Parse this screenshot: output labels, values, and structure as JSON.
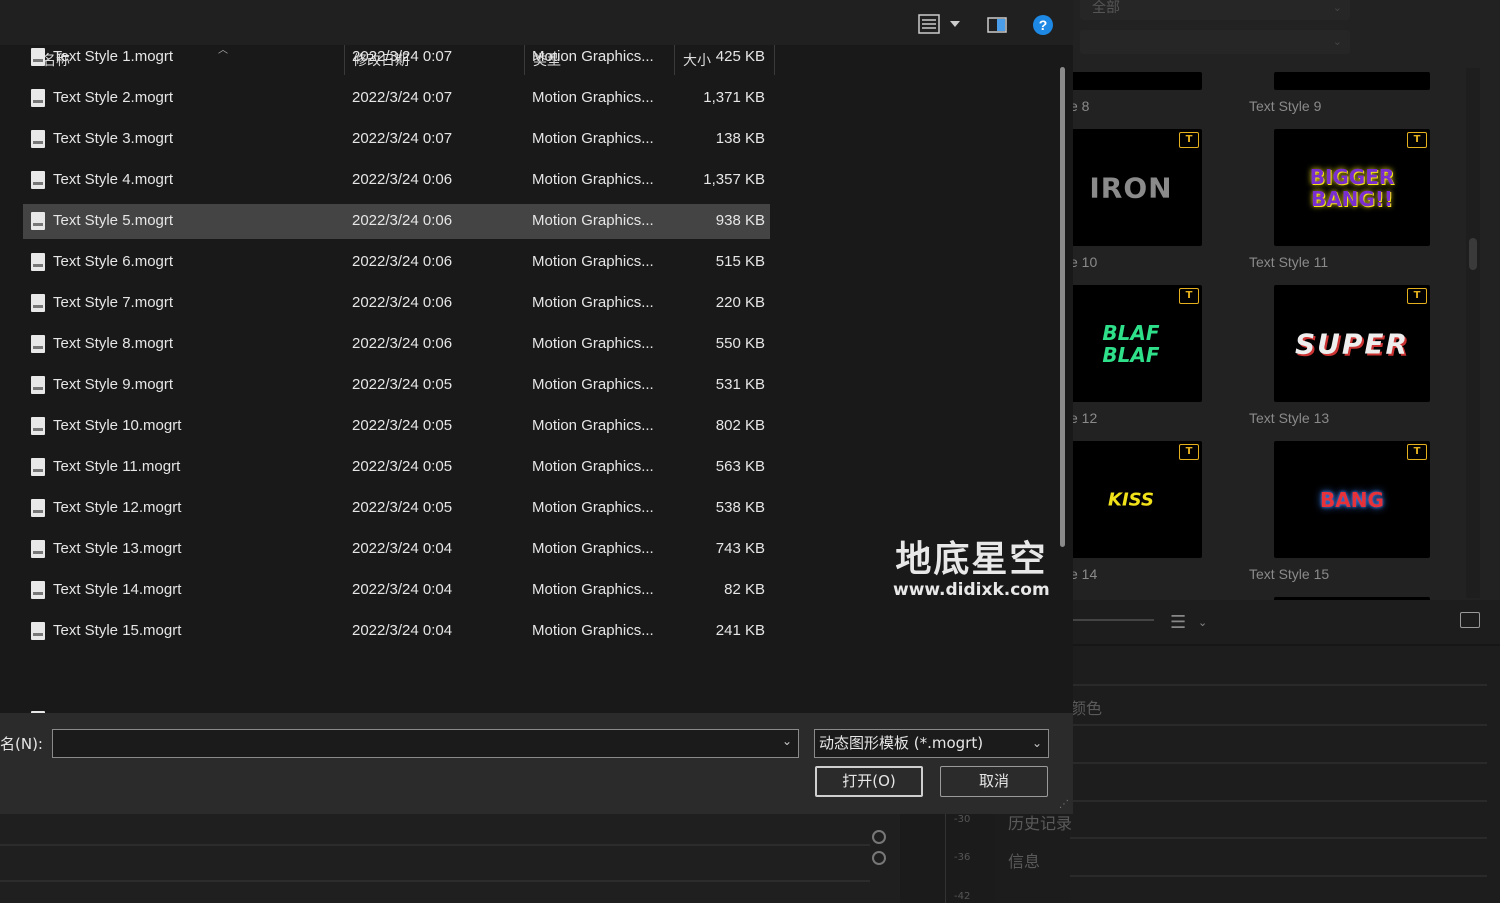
{
  "toolbar": {
    "view_icon": "details-view-icon",
    "dropdown_icon": "chevron-down-icon",
    "preview_icon": "preview-pane-icon",
    "help_icon": "help-icon",
    "help_glyph": "?"
  },
  "columns": {
    "name": "名称",
    "date": "修改日期",
    "type": "类型",
    "size": "大小"
  },
  "files": [
    {
      "name": "Text Style 1.mogrt",
      "date": "2022/3/24 0:07",
      "type": "Motion Graphics...",
      "size": "425 KB"
    },
    {
      "name": "Text Style 2.mogrt",
      "date": "2022/3/24 0:07",
      "type": "Motion Graphics...",
      "size": "1,371 KB"
    },
    {
      "name": "Text Style 3.mogrt",
      "date": "2022/3/24 0:07",
      "type": "Motion Graphics...",
      "size": "138 KB"
    },
    {
      "name": "Text Style 4.mogrt",
      "date": "2022/3/24 0:06",
      "type": "Motion Graphics...",
      "size": "1,357 KB"
    },
    {
      "name": "Text Style 5.mogrt",
      "date": "2022/3/24 0:06",
      "type": "Motion Graphics...",
      "size": "938 KB"
    },
    {
      "name": "Text Style 6.mogrt",
      "date": "2022/3/24 0:06",
      "type": "Motion Graphics...",
      "size": "515 KB"
    },
    {
      "name": "Text Style 7.mogrt",
      "date": "2022/3/24 0:06",
      "type": "Motion Graphics...",
      "size": "220 KB"
    },
    {
      "name": "Text Style 8.mogrt",
      "date": "2022/3/24 0:06",
      "type": "Motion Graphics...",
      "size": "550 KB"
    },
    {
      "name": "Text Style 9.mogrt",
      "date": "2022/3/24 0:05",
      "type": "Motion Graphics...",
      "size": "531 KB"
    },
    {
      "name": "Text Style 10.mogrt",
      "date": "2022/3/24 0:05",
      "type": "Motion Graphics...",
      "size": "802 KB"
    },
    {
      "name": "Text Style 11.mogrt",
      "date": "2022/3/24 0:05",
      "type": "Motion Graphics...",
      "size": "563 KB"
    },
    {
      "name": "Text Style 12.mogrt",
      "date": "2022/3/24 0:05",
      "type": "Motion Graphics...",
      "size": "538 KB"
    },
    {
      "name": "Text Style 13.mogrt",
      "date": "2022/3/24 0:04",
      "type": "Motion Graphics...",
      "size": "743 KB"
    },
    {
      "name": "Text Style 14.mogrt",
      "date": "2022/3/24 0:04",
      "type": "Motion Graphics...",
      "size": "82 KB"
    },
    {
      "name": "Text Style 15.mogrt",
      "date": "2022/3/24 0:04",
      "type": "Motion Graphics...",
      "size": "241 KB"
    }
  ],
  "selected_index": 4,
  "footer": {
    "filename_label": "名(N):",
    "filename_value": "",
    "filetype_value": "动态图形模板 (*.mogrt)",
    "open_label": "打开(O)",
    "cancel_label": "取消"
  },
  "background_panel": {
    "filter_value": "全部",
    "thumbnails": [
      {
        "label": "e 8",
        "art": ""
      },
      {
        "label": "Text Style 9",
        "art": ""
      },
      {
        "label": "e 10",
        "art": "IRON"
      },
      {
        "label": "Text Style 11",
        "art": "BIGGER BANG!!"
      },
      {
        "label": "e 12",
        "art": "BLAF BLAF"
      },
      {
        "label": "Text Style 13",
        "art": "SUPER"
      },
      {
        "label": "e 14",
        "art": "KISS"
      },
      {
        "label": "Text Style 15",
        "art": "BANG"
      }
    ],
    "badge_text": "T",
    "menu_items": [
      "颜色",
      "历史记录",
      "信息"
    ],
    "ruler_ticks": [
      "-30",
      "-36",
      "-42"
    ]
  },
  "watermark": {
    "title": "地底星空",
    "url": "www.didixk.com"
  },
  "colors": {
    "help_blue": "#1e88e5",
    "badge_yellow": "#e4b01e",
    "selection": "#444444"
  }
}
